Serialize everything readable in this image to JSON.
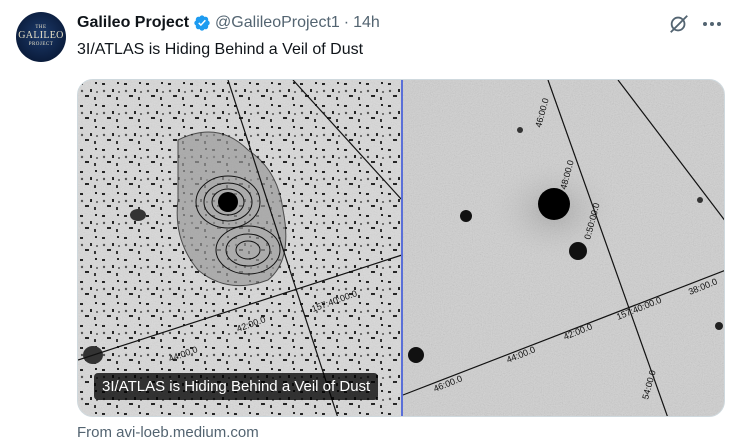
{
  "tweet": {
    "author_name": "Galileo Project",
    "author_handle": "@GalileoProject1",
    "separator": "·",
    "time": "14h",
    "text": "3I/ATLAS is Hiding Behind a Veil of Dust",
    "verified": true
  },
  "avatar": {
    "line1": "THE",
    "line2": "GALILEO",
    "line3": "PROJECT"
  },
  "actions": {
    "grok_icon": "grok-icon",
    "more_icon": "more-options-icon"
  },
  "card": {
    "caption": "3I/ATLAS is Hiding Behind a Veil of Dust",
    "source": "From avi-loeb.medium.com",
    "right_panel_labels": [
      "46:00.0",
      "48:00.0",
      "0:50:00.0",
      "38:00.0",
      "157:40:00.0",
      "42:00.0",
      "44:00.0",
      "46:00.0",
      "54:00.0"
    ],
    "left_panel_labels": [
      "157:40:00.0",
      "42:00.0",
      "44:00.0"
    ]
  },
  "colors": {
    "accent_verified": "#1d9bf0",
    "secondary_text": "#536471",
    "primary_text": "#0f1419"
  }
}
